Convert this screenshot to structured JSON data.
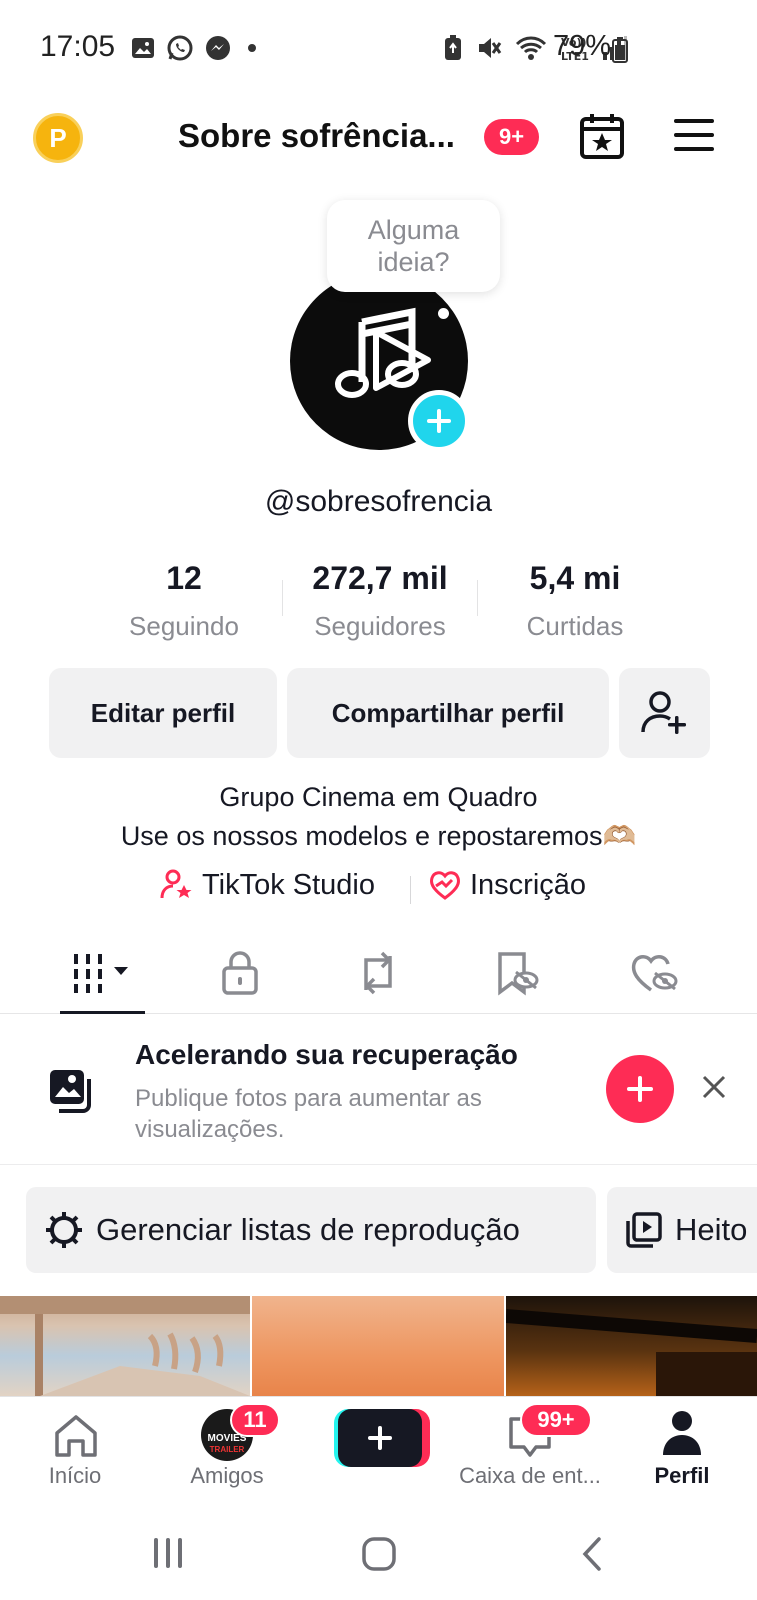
{
  "status_bar": {
    "time": "17:05",
    "battery": "79%"
  },
  "header": {
    "coin_letter": "P",
    "title": "Sobre sofrência...",
    "badge": "9+"
  },
  "bubble": {
    "text_line1": "Alguma",
    "text_line2": "ideia?"
  },
  "profile": {
    "handle": "@sobresofrencia",
    "stats": [
      {
        "value": "12",
        "label": "Seguindo"
      },
      {
        "value": "272,7 mil",
        "label": "Seguidores"
      },
      {
        "value": "5,4 mi",
        "label": "Curtidas"
      }
    ],
    "buttons": {
      "edit": "Editar perfil",
      "share": "Compartilhar perfil"
    },
    "bio_line1": "Grupo Cinema em Quadro",
    "bio_line2": "Use os nossos modelos e repostaremos🫶🏼",
    "links": {
      "studio": "TikTok Studio",
      "subscription": "Inscrição"
    }
  },
  "tabs": [
    "videos",
    "private",
    "reposts",
    "favorites",
    "liked"
  ],
  "promo": {
    "title": "Acelerando sua recuperação",
    "subtitle": "Publique fotos para aumentar as visualizações."
  },
  "chips": {
    "playlists": "Gerenciar listas de reprodução",
    "second": "Heito"
  },
  "bottom_nav": {
    "home": "Início",
    "friends": "Amigos",
    "friends_badge": "11",
    "friends_avatar_text_1": "MOVIES",
    "friends_avatar_text_2": "TRAILER",
    "inbox": "Caixa de ent...",
    "inbox_badge": "99+",
    "profile": "Perfil"
  },
  "colors": {
    "accent": "#fe2c55",
    "cyan": "#20d5ec",
    "coin": "#f6b40e"
  }
}
